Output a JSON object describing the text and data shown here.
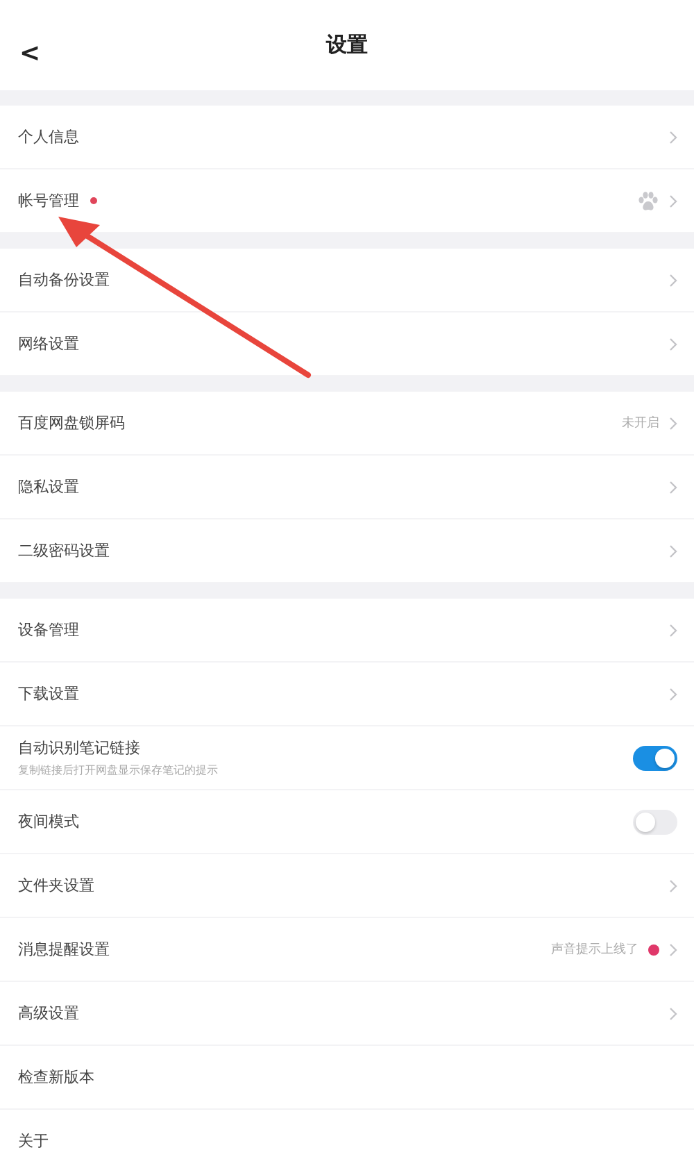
{
  "header": {
    "back": "<",
    "title": "设置"
  },
  "groups": [
    {
      "items": [
        {
          "label": "个人信息",
          "kind": "link"
        },
        {
          "label": "帐号管理",
          "kind": "link",
          "label_dot": true,
          "paw": true
        }
      ]
    },
    {
      "items": [
        {
          "label": "自动备份设置",
          "kind": "link"
        },
        {
          "label": "网络设置",
          "kind": "link"
        }
      ]
    },
    {
      "items": [
        {
          "label": "百度网盘锁屏码",
          "kind": "link",
          "value": "未开启"
        },
        {
          "label": "隐私设置",
          "kind": "link"
        },
        {
          "label": "二级密码设置",
          "kind": "link"
        }
      ]
    },
    {
      "items": [
        {
          "label": "设备管理",
          "kind": "link"
        },
        {
          "label": "下载设置",
          "kind": "link"
        },
        {
          "label": "自动识别笔记链接",
          "kind": "toggle",
          "on": true,
          "sub": "复制链接后打开网盘显示保存笔记的提示"
        },
        {
          "label": "夜间模式",
          "kind": "toggle",
          "on": false
        },
        {
          "label": "文件夹设置",
          "kind": "link"
        },
        {
          "label": "消息提醒设置",
          "kind": "link",
          "value": "声音提示上线了",
          "value_dot": true
        },
        {
          "label": "高级设置",
          "kind": "link"
        },
        {
          "label": "检查新版本",
          "kind": "plain"
        },
        {
          "label": "关于",
          "kind": "plain"
        }
      ]
    }
  ]
}
